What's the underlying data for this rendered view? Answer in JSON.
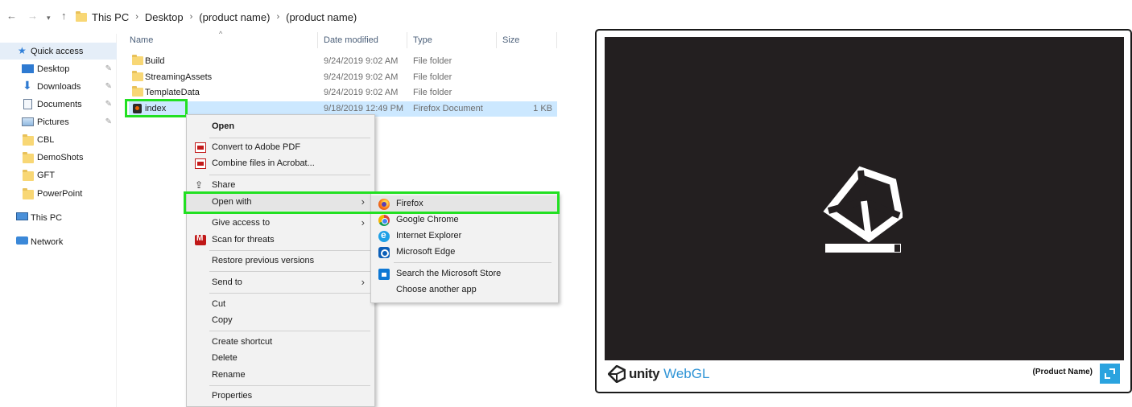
{
  "explorer": {
    "breadcrumb": [
      "This PC",
      "Desktop",
      "(product name)",
      "(product name)"
    ],
    "sidebar": [
      {
        "label": "Quick access",
        "icon": "star-icon",
        "pinned": false
      },
      {
        "label": "Desktop",
        "icon": "desktop-icon",
        "pinned": true
      },
      {
        "label": "Downloads",
        "icon": "downloads-icon",
        "pinned": true
      },
      {
        "label": "Documents",
        "icon": "documents-icon",
        "pinned": true
      },
      {
        "label": "Pictures",
        "icon": "pictures-icon",
        "pinned": true
      },
      {
        "label": "CBL",
        "icon": "folder-icon",
        "pinned": false
      },
      {
        "label": "DemoShots",
        "icon": "folder-icon",
        "pinned": false
      },
      {
        "label": "GFT",
        "icon": "folder-icon",
        "pinned": false
      },
      {
        "label": "PowerPoint",
        "icon": "folder-icon",
        "pinned": false
      },
      {
        "label": "This PC",
        "icon": "this-pc-icon",
        "pinned": false
      },
      {
        "label": "Network",
        "icon": "network-icon",
        "pinned": false
      }
    ],
    "columns": {
      "name": "Name",
      "date": "Date modified",
      "type": "Type",
      "size": "Size"
    },
    "files": [
      {
        "name": "Build",
        "date": "9/24/2019 9:02 AM",
        "type": "File folder",
        "size": ""
      },
      {
        "name": "StreamingAssets",
        "date": "9/24/2019 9:02 AM",
        "type": "File folder",
        "size": ""
      },
      {
        "name": "TemplateData",
        "date": "9/24/2019 9:02 AM",
        "type": "File folder",
        "size": ""
      },
      {
        "name": "index",
        "date": "9/18/2019 12:49 PM",
        "type": "Firefox Document",
        "size": "1 KB"
      }
    ]
  },
  "context_menu": {
    "items": [
      "Open",
      "Convert to Adobe PDF",
      "Combine files in Acrobat...",
      "Share",
      "Open with",
      "Give access to",
      "Scan for threats",
      "Restore previous versions",
      "Send to",
      "Cut",
      "Copy",
      "Create shortcut",
      "Delete",
      "Rename",
      "Properties"
    ]
  },
  "open_with_menu": {
    "items": [
      "Firefox",
      "Google Chrome",
      "Internet Explorer",
      "Microsoft Edge",
      "Search the Microsoft Store",
      "Choose another app"
    ]
  },
  "player": {
    "brand": "unity",
    "platform": "WebGL",
    "product_name": "(Product Name)",
    "progress": 0.9,
    "canvas_color": "#231f20",
    "accent": "#2aa3df"
  }
}
